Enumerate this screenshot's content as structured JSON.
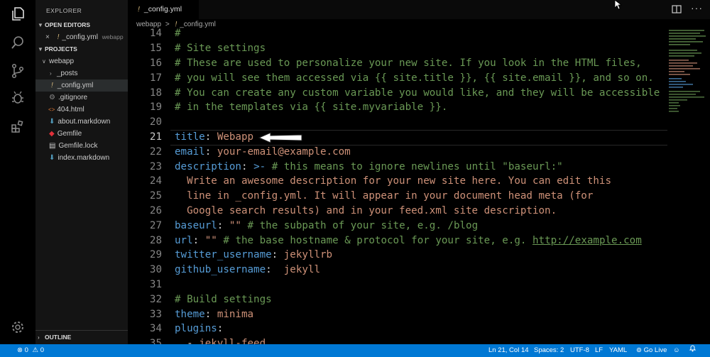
{
  "explorer": {
    "title": "EXPLORER",
    "open_editors_label": "OPEN EDITORS",
    "open_editor": {
      "name": "_config.yml",
      "folder": "webapp"
    },
    "projects_label": "PROJECTS",
    "root_folder": "webapp",
    "files": [
      "_posts",
      "_config.yml",
      ".gitignore",
      "404.html",
      "about.markdown",
      "Gemfile",
      "Gemfile.lock",
      "index.markdown"
    ],
    "outline_label": "OUTLINE"
  },
  "tab": {
    "label": "_config.yml",
    "icon_glyph": "!"
  },
  "breadcrumb": {
    "folder": "webapp",
    "sep": ">",
    "file": "_config.yml"
  },
  "editor": {
    "line_numbers": [
      "14",
      "15",
      "16",
      "17",
      "18",
      "19",
      "20",
      "21",
      "22",
      "23",
      "24",
      "25",
      "26",
      "27",
      "28",
      "29",
      "30",
      "31",
      "32",
      "33",
      "34",
      "35"
    ],
    "current_line": "21"
  },
  "status": {
    "errors": "0",
    "warnings": "0",
    "position": "Ln 21, Col 14",
    "spaces": "Spaces: 2",
    "encoding": "UTF-8",
    "eol": "LF",
    "language": "YAML",
    "go_live": "Go Live"
  },
  "colors": {
    "status_bar": "#0078d4",
    "comment": "#6a9955",
    "key": "#569cd6",
    "string": "#ce9178"
  },
  "icons": [
    "files-icon",
    "search-icon",
    "source-control-icon",
    "debug-icon",
    "extensions-icon",
    "settings-gear-icon",
    "split-editor-icon",
    "more-actions-icon",
    "error-icon",
    "warning-icon",
    "broadcast-icon",
    "account-icon",
    "bell-icon"
  ]
}
